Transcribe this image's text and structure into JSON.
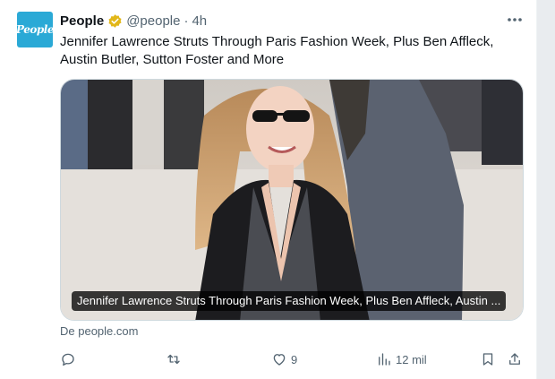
{
  "tweet": {
    "avatar_text": "People",
    "author_name": "People",
    "handle": "@people",
    "separator": "·",
    "time": "4h",
    "text": "Jennifer Lawrence Struts Through Paris Fashion Week, Plus Ben Affleck, Austin Butler, Sutton Foster and More",
    "card_caption": "Jennifer Lawrence Struts Through Paris Fashion Week, Plus Ben Affleck, Austin ...",
    "source": "De people.com"
  },
  "actions": {
    "reply_count": "",
    "retweet_count": "",
    "like_count": "9",
    "views_count": "12 mil"
  },
  "colors": {
    "accent": "#1d9bf0",
    "muted": "#536471",
    "verified_gold": "#e2b719",
    "avatar_bg": "#2aa9d6"
  },
  "icons": [
    "verified-badge-icon",
    "more-icon",
    "reply-icon",
    "retweet-icon",
    "like-icon",
    "views-icon",
    "bookmark-icon",
    "share-icon"
  ]
}
